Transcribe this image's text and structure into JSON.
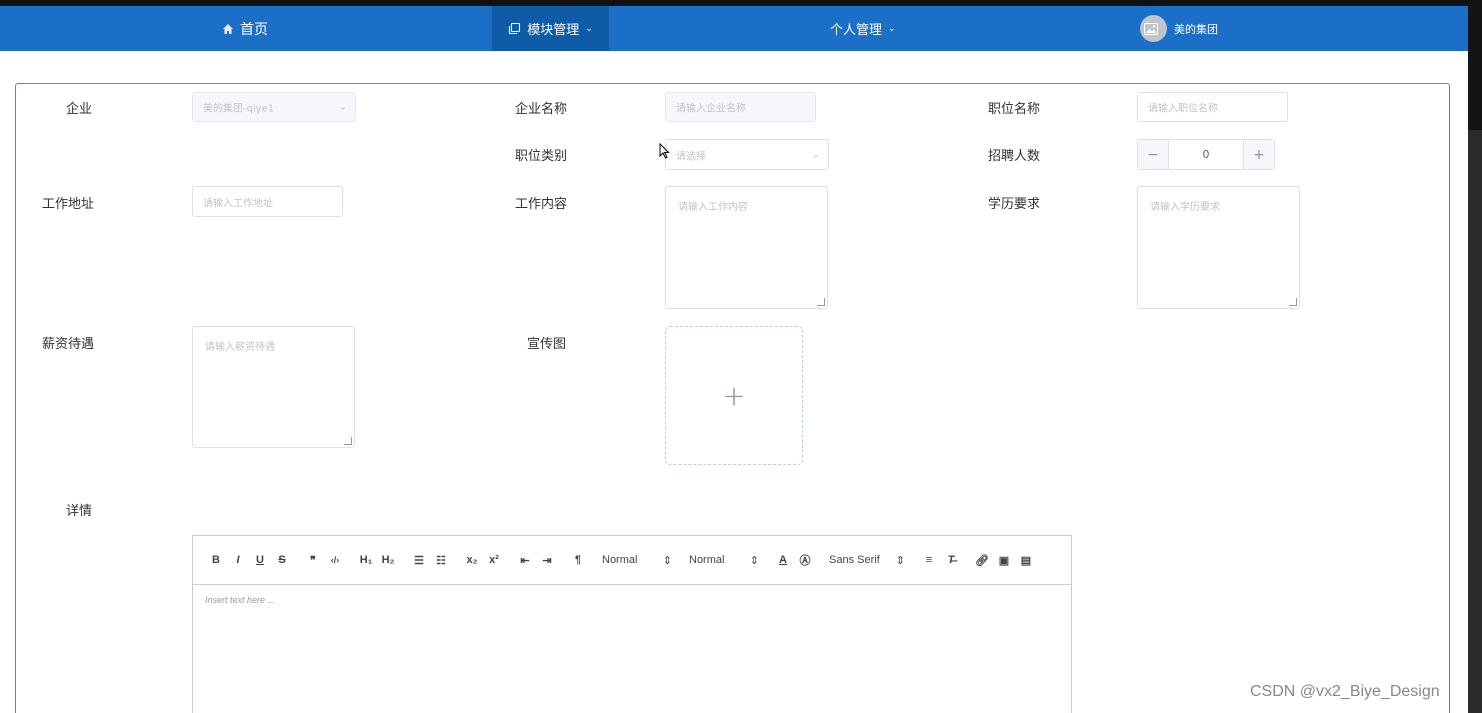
{
  "nav": {
    "home": "首页",
    "module": "模块管理",
    "personal": "个人管理",
    "user": "美的集团"
  },
  "form": {
    "company_label": "企业",
    "company_value": "美的集团-qiye1",
    "company_name_label": "企业名称",
    "company_name_ph": "请输入企业名称",
    "position_name_label": "职位名称",
    "position_name_ph": "请输入职位名称",
    "position_type_label": "职位类别",
    "position_type_ph": "请选择",
    "hire_count_label": "招聘人数",
    "hire_count_value": "0",
    "address_label": "工作地址",
    "address_ph": "请输入工作地址",
    "content_label": "工作内容",
    "content_ph": "请输入工作内容",
    "education_label": "学历要求",
    "education_ph": "请输入学历要求",
    "salary_label": "薪资待遇",
    "salary_ph": "请输入薪资待遇",
    "poster_label": "宣传图",
    "detail_label": "详情"
  },
  "editor": {
    "header_select": "Normal",
    "size_select": "Normal",
    "font_select": "Sans Serif",
    "placeholder": "Insert text here ..."
  },
  "watermark": "CSDN @vx2_Biye_Design"
}
